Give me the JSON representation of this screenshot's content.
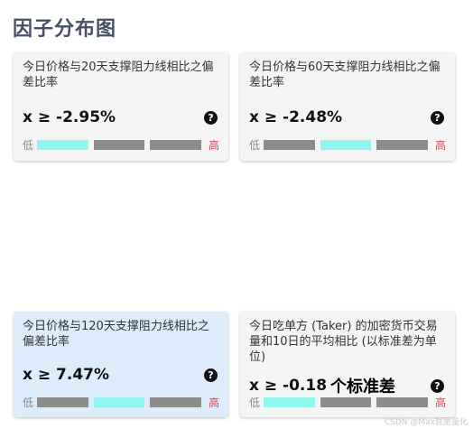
{
  "title": "因子分布图",
  "cards": [
    {
      "desc": "今日价格与20天支撑阻力线相比之偏差比率",
      "value": "x ≥ -2.95%",
      "unit": "",
      "low": "低",
      "high": "高",
      "active_segment": 1
    },
    {
      "desc": "今日价格与60天支撑阻力线相比之偏差比率",
      "value": "x ≥ -2.48%",
      "unit": "",
      "low": "低",
      "high": "高",
      "active_segment": 2
    },
    {
      "desc": "今日价格与120天支撑阻力线相比之偏差比率",
      "value": "x ≥ 7.47%",
      "unit": "",
      "low": "低",
      "high": "高",
      "active_segment": 2
    },
    {
      "desc": "今日吃单方 (Taker) 的加密货币交易量和10日的平均相比 (以标准差为单位)",
      "value": "x ≥ -0.18",
      "unit": "个标准差",
      "low": "低",
      "high": "高",
      "active_segment": 1
    }
  ],
  "help_icon": "question-circle-icon",
  "colors": {
    "active_segment": "#8ff7ef",
    "inactive_segment": "#8c8c8c",
    "high_label": "#d6455a",
    "highlight_card": "#dcecfb"
  },
  "watermark": "CSDN @Max就是量化"
}
